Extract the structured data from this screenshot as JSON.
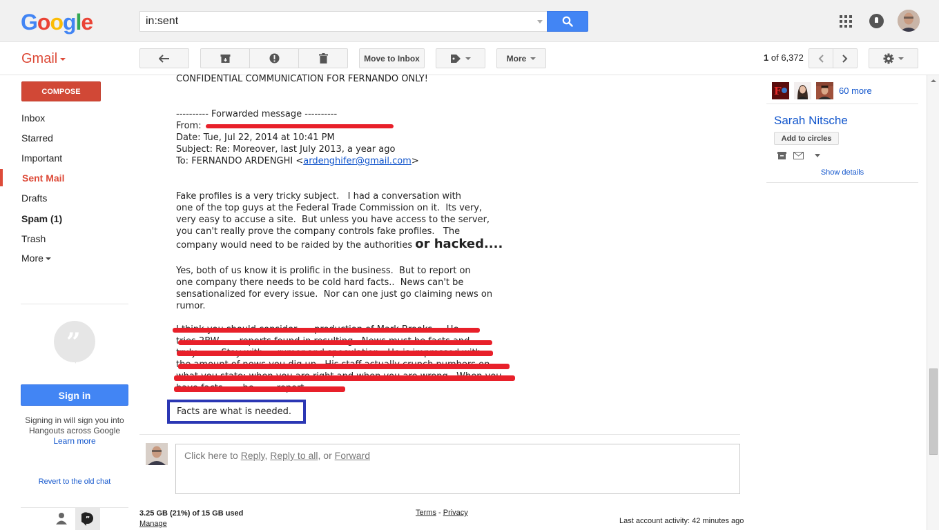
{
  "header": {
    "logo": "Google",
    "search_value": "in:sent"
  },
  "toolbar": {
    "app_label": "Gmail",
    "move_to_inbox": "Move to Inbox",
    "more": "More",
    "page_current": "1",
    "page_of": "of 6,372"
  },
  "sidebar": {
    "compose": "COMPOSE",
    "items": [
      {
        "label": "Inbox"
      },
      {
        "label": "Starred"
      },
      {
        "label": "Important"
      },
      {
        "label": "Sent Mail"
      },
      {
        "label": "Drafts"
      },
      {
        "label": "Spam (1)"
      },
      {
        "label": "Trash"
      },
      {
        "label": "More"
      }
    ],
    "sign_in": "Sign in",
    "sign_in_text": "Signing in will sign you into Hangouts across Google",
    "learn_more": "Learn more",
    "revert_chat": "Revert to the old chat"
  },
  "message": {
    "confidential": "CONFIDENTIAL COMMUNICATION FOR FERNANDO ONLY!",
    "forwarded": "---------- Forwarded message ----------",
    "from_label": "From: ",
    "date": "Date: Tue, Jul 22, 2014 at 10:41 PM",
    "subject": "Subject: Re: Moreover, last July 2013, a year ago",
    "to_prefix": "To: FERNANDO ARDENGHI <",
    "to_email": "ardenghifer@gmail.com",
    "to_suffix": ">",
    "p1_line1": "Fake profiles is a very tricky subject.   I had a conversation with",
    "p1_line2": "one of the top guys at the Federal Trade Commission on it.  Its very,",
    "p1_line3": "very easy to accuse a site.  But unless you have access to the server,",
    "p1_line4": "you can't really prove the company controls fake profiles.   The",
    "p1_line5": "company would need to be raided by the authorities ",
    "p1_big": "or hacked....",
    "p2_line1": "Yes, both of us know it is prolific in the business.  But to report on",
    "p2_line2": "one company there needs to be cold hard facts..  News can't be",
    "p2_line3": "sensationalized for every issue.  Nor can one just go claiming news on",
    "p2_line4": "rumor.",
    "r_line1": "I think you should consider .... production of Mark Brooks...  He",
    "r_line2": "tries 2BW ..... reports found in resulting.  News must be facts and",
    "r_line3": "truly.......  Stay with ... rumor and speculation.  He is impressed with",
    "r_line4": "the amount of news you dig up.  His staff actually crunch numbers on",
    "r_line5": "what you state; when you are right and when you are wrong.  When you",
    "r_line6": "have facts, .... he ...... report .....",
    "facts": "Facts are what is needed."
  },
  "reply": {
    "prefix": "Click here to ",
    "reply": "Reply",
    "sep1": ", ",
    "reply_all": "Reply to all",
    "sep2": ", or ",
    "forward": "Forward"
  },
  "footer": {
    "storage": "3.25 GB (21%) of 15 GB used",
    "manage": "Manage",
    "terms": "Terms",
    "dash": " - ",
    "privacy": "Privacy",
    "last_activity": "Last account activity: 42 minutes ago"
  },
  "right_panel": {
    "more_people": "60 more",
    "contact_name": "Sarah Nitsche",
    "add_to_circles": "Add to circles",
    "show_details": "Show details"
  },
  "colors": {
    "google_blue": "#4285f4",
    "gmail_red": "#dd4b39",
    "compose_red": "#d14836",
    "link_blue": "#1155cc",
    "redaction_red": "#e8202a",
    "highlight_box": "#2b37b4"
  }
}
